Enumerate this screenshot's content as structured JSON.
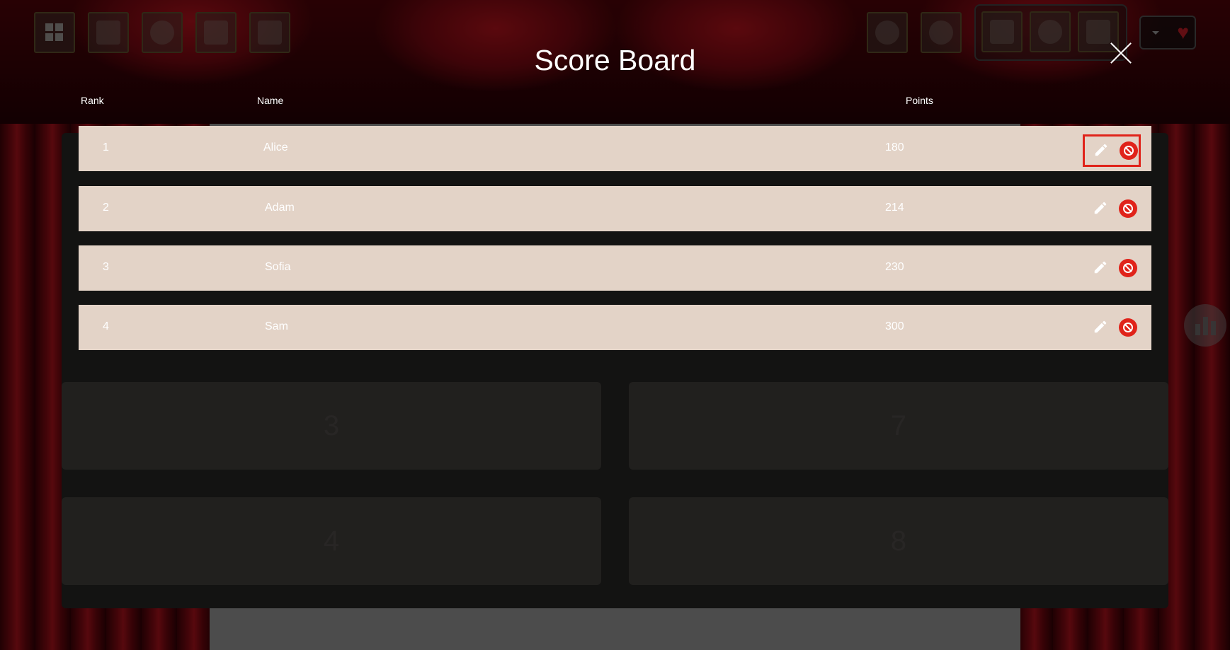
{
  "window": {
    "title": "Score Board"
  },
  "toolbar_left": [
    {
      "name": "grid-icon"
    },
    {
      "name": "exit-icon"
    },
    {
      "name": "target-icon"
    },
    {
      "name": "edit-board-icon"
    },
    {
      "name": "trophy-icon"
    }
  ],
  "toolbar_right": [
    {
      "name": "smiley-icon"
    },
    {
      "name": "at-sign-icon"
    }
  ],
  "toolbar_group": [
    {
      "name": "wand-icon"
    },
    {
      "name": "stop-icon"
    },
    {
      "name": "sound-icon"
    }
  ],
  "heart": {
    "icon": "heart-icon",
    "glyph": "♥",
    "color": "#d8202a"
  },
  "columns": {
    "rank": "Rank",
    "name": "Name",
    "points": "Points"
  },
  "rows": [
    {
      "rank": "1",
      "name": "Alice",
      "points": "180"
    },
    {
      "rank": "2",
      "name": "Adam",
      "points": "214"
    },
    {
      "rank": "3",
      "name": "Sofia",
      "points": "230"
    },
    {
      "rank": "4",
      "name": "Sam",
      "points": "300"
    }
  ],
  "board_tiles": [
    "3",
    "7",
    "4",
    "8"
  ],
  "colors": {
    "row_bg": "#e3d3c7",
    "accent_red": "#e0231a"
  }
}
